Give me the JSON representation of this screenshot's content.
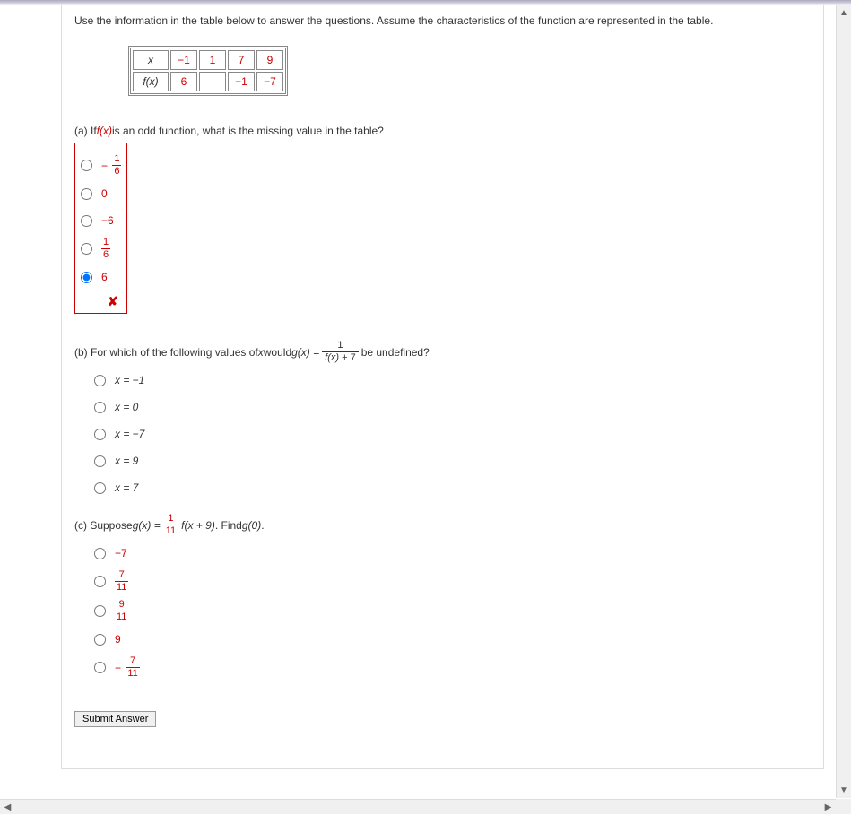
{
  "instructions": "Use the information in the table below to answer the questions. Assume the characteristics of the function are represented in the table.",
  "table": {
    "r1": {
      "h": "x",
      "c1": "−1",
      "c2": "1",
      "c3": "7",
      "c4": "9"
    },
    "r2": {
      "h": "f(x)",
      "c1": "6",
      "c2": "",
      "c3": "−1",
      "c4": "−7"
    }
  },
  "a": {
    "prompt_pre": "(a) If  ",
    "prompt_fx": "f(x)",
    "prompt_post": "  is an odd function, what is the missing value in the table?",
    "opts": {
      "o1": {
        "negSign": "−",
        "num": "1",
        "den": "6"
      },
      "o2": "0",
      "o3": "−6",
      "o4": {
        "num": "1",
        "den": "6"
      },
      "o5": "6"
    }
  },
  "b": {
    "prompt_pre": "(b) For which of the following values of ",
    "x": "x",
    "prompt_mid": " would  ",
    "gx": "g(x) = ",
    "frac_num": "1",
    "frac_den_fx": "f(x)",
    "frac_den_plus": " + 7",
    "prompt_post": "  be undefined?",
    "opts": {
      "o1": "x = −1",
      "o2": "x = 0",
      "o3": "x = −7",
      "o4": "x = 9",
      "o5": "x = 7"
    }
  },
  "c": {
    "prompt_pre": "(c) Suppose  ",
    "gx": "g(x) = ",
    "frac_num": "1",
    "frac_den": "11",
    "fxpart": "f(x + 9)",
    "prompt_mid": " . Find  ",
    "g0": "g(0)",
    "prompt_post": " .",
    "opts": {
      "o1": "−7",
      "o2": {
        "num": "7",
        "den": "11"
      },
      "o3": {
        "num": "9",
        "den": "11"
      },
      "o4": "9",
      "o5": {
        "negSign": "−",
        "num": "7",
        "den": "11"
      }
    }
  },
  "submit": "Submit Answer"
}
